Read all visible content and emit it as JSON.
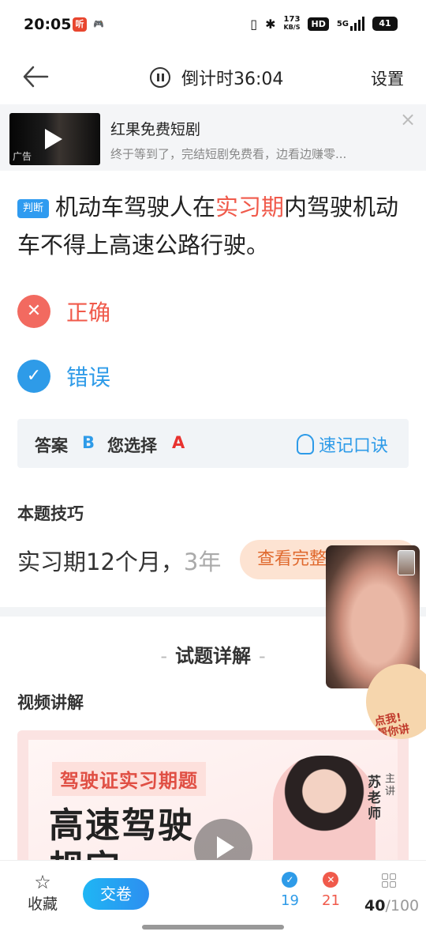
{
  "status_bar": {
    "time": "20:05",
    "speed_top": "173",
    "speed_bottom": "KB/S",
    "hd": "HD",
    "network": "5G",
    "battery": "41"
  },
  "header": {
    "timer_text": "倒计时36:04",
    "settings_label": "设置"
  },
  "ad": {
    "title": "红果免费短剧",
    "description": "终于等到了，完结短剧免费看，边看边赚零...",
    "tag": "广告"
  },
  "question": {
    "type_tag": "判断",
    "text_before": "机动车驾驶人在",
    "highlight": "实习期",
    "text_after": "内驾驶机动车不得上高速公路行驶。"
  },
  "options": [
    {
      "label": "正确",
      "state": "wrong-selected"
    },
    {
      "label": "错误",
      "state": "correct"
    }
  ],
  "answer": {
    "answer_label": "答案",
    "answer_value": "B",
    "selected_label": "您选择",
    "selected_value": "A",
    "mnemonic_label": "速记口诀"
  },
  "tip": {
    "title": "本题技巧",
    "text": "实习期12个月，",
    "text_faded": "3年",
    "view_full": "查看完整"
  },
  "detail": {
    "title": "试题详解",
    "video_label": "视频讲解",
    "video_tag": "驾驶证实习期题",
    "video_headline_1": "高速驾驶",
    "video_headline_2": "规定",
    "presenter_name": "苏老师",
    "presenter_role": "主讲"
  },
  "promo": {
    "text_1": "点我!",
    "text_2": "帮你讲"
  },
  "bottom_bar": {
    "favorite_label": "收藏",
    "submit_label": "交卷",
    "correct_count": "19",
    "wrong_count": "21",
    "current": "40",
    "total": "/100"
  }
}
